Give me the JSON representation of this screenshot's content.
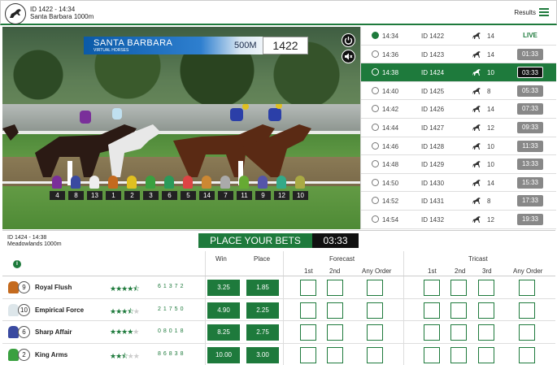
{
  "header": {
    "race_id_time": "ID 1422 - 14:34",
    "venue": "Santa Barbara 1000m",
    "results_label": "Results",
    "accent": "#1e7a3c"
  },
  "video": {
    "venue": "SANTA BARBARA",
    "subtitle": "VIRTUAL HORSES",
    "distance": "500M",
    "race_number": "1422",
    "runner_numbers": [
      "4",
      "8",
      "13",
      "1",
      "2",
      "3",
      "6",
      "5",
      "14",
      "7",
      "11",
      "9",
      "12",
      "10"
    ]
  },
  "races": [
    {
      "time": "14:34",
      "id": "ID 1422",
      "runners": "14",
      "countdown": "LIVE",
      "state": "live"
    },
    {
      "time": "14:36",
      "id": "ID 1423",
      "runners": "14",
      "countdown": "01:33",
      "state": ""
    },
    {
      "time": "14:38",
      "id": "ID 1424",
      "runners": "10",
      "countdown": "03:33",
      "state": "sel"
    },
    {
      "time": "14:40",
      "id": "ID 1425",
      "runners": "8",
      "countdown": "05:33",
      "state": ""
    },
    {
      "time": "14:42",
      "id": "ID 1426",
      "runners": "14",
      "countdown": "07:33",
      "state": ""
    },
    {
      "time": "14:44",
      "id": "ID 1427",
      "runners": "12",
      "countdown": "09:33",
      "state": ""
    },
    {
      "time": "14:46",
      "id": "ID 1428",
      "runners": "10",
      "countdown": "11:33",
      "state": ""
    },
    {
      "time": "14:48",
      "id": "ID 1429",
      "runners": "10",
      "countdown": "13:33",
      "state": ""
    },
    {
      "time": "14:50",
      "id": "ID 1430",
      "runners": "14",
      "countdown": "15:33",
      "state": ""
    },
    {
      "time": "14:52",
      "id": "ID 1431",
      "runners": "8",
      "countdown": "17:33",
      "state": ""
    },
    {
      "time": "14:54",
      "id": "ID 1432",
      "runners": "12",
      "countdown": "19:33",
      "state": ""
    }
  ],
  "bets": {
    "race_id_time": "ID 1424 - 14:38",
    "venue": "Meadowlands 1000m",
    "place_your_bets": "PLACE YOUR BETS",
    "countdown": "03:33",
    "headers": {
      "win": "Win",
      "place": "Place",
      "forecast": "Forecast",
      "tricast": "Tricast",
      "first": "1st",
      "second": "2nd",
      "third": "3rd",
      "any_order": "Any Order"
    },
    "runners": [
      {
        "number": "9",
        "name": "Royal Flush",
        "rating": 4.5,
        "form": "61372",
        "win": "3.25",
        "place": "1.85",
        "silk": "#c46a1e"
      },
      {
        "number": "10",
        "name": "Empirical Force",
        "rating": 3.5,
        "form": "21750",
        "win": "4.90",
        "place": "2.25",
        "silk": "#dde6ea"
      },
      {
        "number": "6",
        "name": "Sharp Affair",
        "rating": 4,
        "form": "08018",
        "win": "8.25",
        "place": "2.75",
        "silk": "#3a4aa0"
      },
      {
        "number": "2",
        "name": "King Arms",
        "rating": 2.5,
        "form": "86838",
        "win": "10.00",
        "place": "3.00",
        "silk": "#3aa040"
      }
    ]
  }
}
